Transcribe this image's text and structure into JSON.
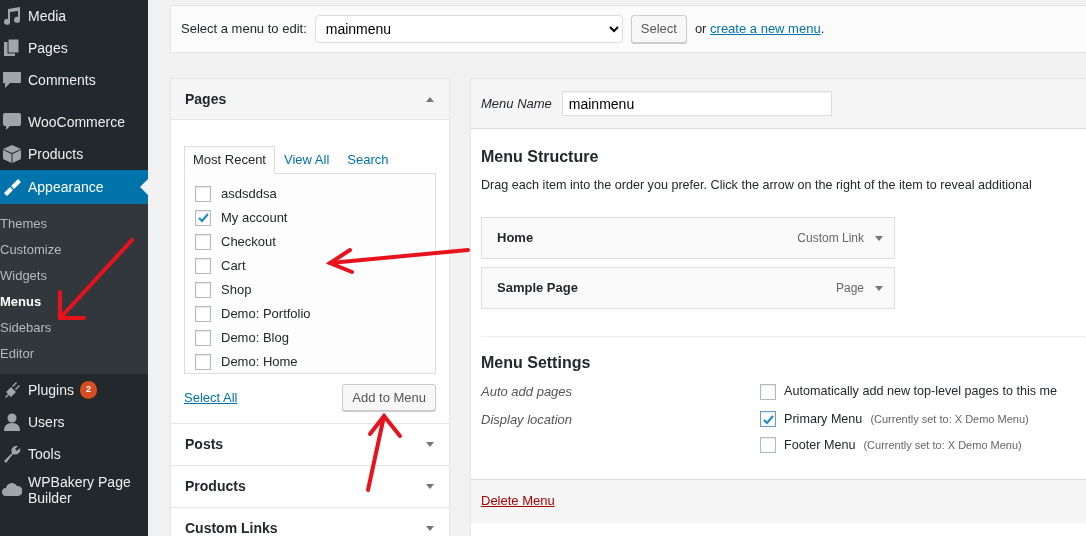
{
  "sidebar": {
    "items": [
      {
        "label": "Media",
        "selected": false
      },
      {
        "label": "Pages",
        "selected": false
      },
      {
        "label": "Comments",
        "selected": false
      },
      {
        "label": "WooCommerce",
        "selected": false,
        "gap_before": true
      },
      {
        "label": "Products",
        "selected": false
      },
      {
        "label": "Appearance",
        "selected": true,
        "children": [
          {
            "label": "Themes",
            "selected": false
          },
          {
            "label": "Customize",
            "selected": false
          },
          {
            "label": "Widgets",
            "selected": false
          },
          {
            "label": "Menus",
            "selected": true
          },
          {
            "label": "Sidebars",
            "selected": false
          },
          {
            "label": "Editor",
            "selected": false
          }
        ]
      },
      {
        "label": "Plugins",
        "selected": false,
        "badge": "2"
      },
      {
        "label": "Users",
        "selected": false
      },
      {
        "label": "Tools",
        "selected": false
      },
      {
        "label": "WPBakery Page Builder",
        "selected": false
      }
    ]
  },
  "menu_select": {
    "label": "Select a menu to edit:",
    "value": "mainmenu",
    "button": "Select",
    "prompt_before": "or ",
    "prompt_link": "create a new menu",
    "prompt_after": "."
  },
  "pages_box": {
    "title": "Pages",
    "expanded": true,
    "tabs": [
      {
        "label": "Most Recent",
        "selected": true
      },
      {
        "label": "View All",
        "selected": false
      },
      {
        "label": "Search",
        "selected": false
      }
    ],
    "items": [
      {
        "label": "asdsddsa",
        "checked": false
      },
      {
        "label": "My account",
        "checked": true
      },
      {
        "label": "Checkout",
        "checked": false
      },
      {
        "label": "Cart",
        "checked": false
      },
      {
        "label": "Shop",
        "checked": false
      },
      {
        "label": "Demo: Portfolio",
        "checked": false
      },
      {
        "label": "Demo: Blog",
        "checked": false
      },
      {
        "label": "Demo: Home",
        "checked": false
      }
    ],
    "select_all": "Select All",
    "add_button": "Add to Menu"
  },
  "other_boxes": [
    {
      "title": "Posts",
      "expanded": false
    },
    {
      "title": "Products",
      "expanded": false
    },
    {
      "title": "Custom Links",
      "expanded": false
    }
  ],
  "menu_name": {
    "label": "Menu Name",
    "value": "mainmenu"
  },
  "structure": {
    "title": "Menu Structure",
    "description": "Drag each item into the order you prefer. Click the arrow on the right of the item to reveal additional",
    "items": [
      {
        "title": "Home",
        "type": "Custom Link"
      },
      {
        "title": "Sample Page",
        "type": "Page"
      }
    ]
  },
  "settings": {
    "title": "Menu Settings",
    "rows": [
      {
        "label": "Auto add pages",
        "options": [
          {
            "label": "Automatically add new top-level pages to this me",
            "checked": false
          }
        ]
      },
      {
        "label": "Display location",
        "options": [
          {
            "label": "Primary Menu",
            "note": "(Currently set to: X Demo Menu)",
            "checked": true
          },
          {
            "label": "Footer Menu",
            "note": "(Currently set to: X Demo Menu)",
            "checked": false
          }
        ]
      }
    ]
  },
  "delete_link": "Delete Menu"
}
